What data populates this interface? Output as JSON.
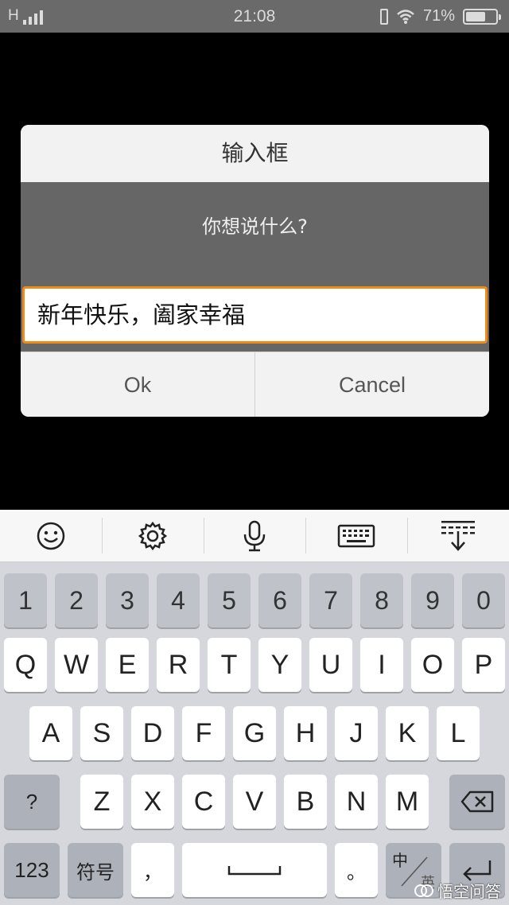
{
  "status_bar": {
    "network": "H",
    "time": "21:08",
    "battery_percent": "71%",
    "battery_level": 0.71
  },
  "dialog": {
    "title": "输入框",
    "message": "你想说什么?",
    "input_value": "新年快乐，阖家幸福",
    "ok_label": "Ok",
    "cancel_label": "Cancel",
    "accent_color": "#f28a17"
  },
  "keyboard": {
    "toolbar": [
      "emoji-icon",
      "gear-icon",
      "microphone-icon",
      "keyboard-icon",
      "collapse-keyboard-icon"
    ],
    "number_row": [
      "1",
      "2",
      "3",
      "4",
      "5",
      "6",
      "7",
      "8",
      "9",
      "0"
    ],
    "row1": [
      "Q",
      "W",
      "E",
      "R",
      "T",
      "Y",
      "U",
      "I",
      "O",
      "P"
    ],
    "row2": [
      "A",
      "S",
      "D",
      "F",
      "G",
      "H",
      "J",
      "K",
      "L"
    ],
    "row3": [
      "Z",
      "X",
      "C",
      "V",
      "B",
      "N",
      "M"
    ],
    "shift_label": "?",
    "num_toggle_label": "123",
    "symbol_label": "符号",
    "comma_label": "，",
    "period_label": "。",
    "lang_label": "中",
    "lang_sub_label": "英"
  },
  "watermark": {
    "text": "悟空问答"
  }
}
